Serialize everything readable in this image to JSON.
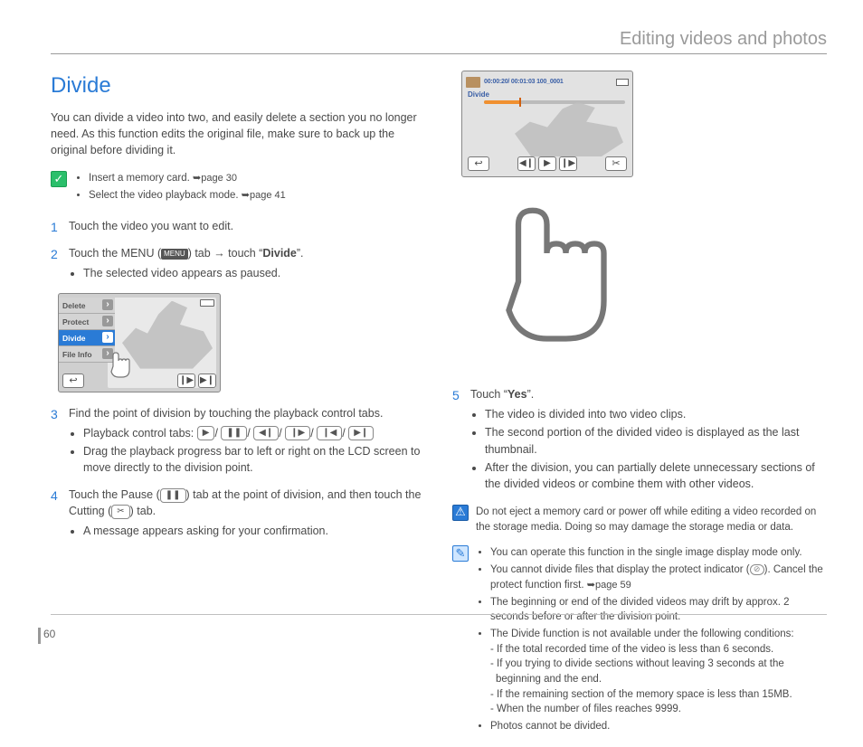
{
  "header": {
    "title": "Editing videos and photos"
  },
  "page_number": "60",
  "section": {
    "title": "Divide",
    "intro": "You can divide a video into two, and easily delete a section you no longer need. As this function edits the original file, make sure to back up the original before dividing it."
  },
  "prereq": {
    "items": [
      {
        "pre": "Insert a memory card. ",
        "ref": "page 30"
      },
      {
        "pre": "Select the video playback mode. ",
        "ref": "page 41"
      }
    ]
  },
  "steps": {
    "s1": {
      "num": "1",
      "text": "Touch the video you want to edit."
    },
    "s2": {
      "num": "2",
      "pre": "Touch the MENU (",
      "menu_label": "MENU",
      "mid": ") tab ",
      "arrow": "→",
      "tail_pre": " touch “",
      "tail_bold": "Divide",
      "tail_post": "”.",
      "sub1": "The selected video appears as paused."
    },
    "s3": {
      "num": "3",
      "text": "Find the point of division by touching the playback control tabs.",
      "sub_label": "Playback control tabs: ",
      "p1": "▶",
      "p2": "❚❚",
      "p3": "◀❙",
      "p4": "❙▶",
      "p5": "❙◀",
      "p6": "▶❙",
      "sub2": "Drag the playback progress bar to left or right on the LCD screen to move directly to the division point."
    },
    "s4": {
      "num": "4",
      "pre": "Touch the Pause (",
      "pause_glyph": "❚❚",
      "mid": ") tab at the point of division, and then touch the Cutting (",
      "cut_glyph": "✂",
      "post": ") tab.",
      "sub1": "A message appears asking for your confirmation."
    },
    "s5": {
      "num": "5",
      "pre": "Touch “",
      "bold": "Yes",
      "post": "”.",
      "sub1": "The video is divided into two video clips.",
      "sub2": "The second portion of the divided video is displayed as the last thumbnail.",
      "sub3": "After the division, you can partially delete unnecessary sections of the divided videos or combine them with other videos."
    }
  },
  "lcd1": {
    "menu_items": [
      "Delete",
      "Protect",
      "Divide",
      "File Info"
    ],
    "active_index": 2,
    "back": "↩",
    "ctrl1": "❙▶",
    "ctrl2": "▶❙"
  },
  "lcd2": {
    "timecode": "00:00:20/ 00:01:03   100_0001",
    "divide_label": "Divide",
    "back": "↩",
    "c1": "◀❙",
    "c2": "▶",
    "c3": "❙▶",
    "cut": "✂"
  },
  "warn": {
    "glyph": "⚠",
    "text": "Do not eject a memory card or power off while editing a video recorded on the storage media. Doing so may damage the storage media or data."
  },
  "notes": {
    "glyph": "✎",
    "n1": "You can operate this function in the single image display mode only.",
    "n2_pre": "You cannot divide files that display the protect indicator (",
    "n2_glyph": "⊘",
    "n2_mid": "). Cancel the protect function first. ",
    "n2_ref": "page 59",
    "n3": "The beginning or end of the divided videos may drift by approx. 2 seconds before or after the division point.",
    "n4": "The Divide function is not available under the following conditions:",
    "d1": "- If the total recorded time of the video is less than 6 seconds.",
    "d2": "- If you trying to divide sections without leaving 3 seconds at the beginning and the end.",
    "d3": "- If the remaining section of the memory space is less than 15MB.",
    "d4": "- When the number of files reaches 9999.",
    "n5": "Photos cannot be divided."
  }
}
